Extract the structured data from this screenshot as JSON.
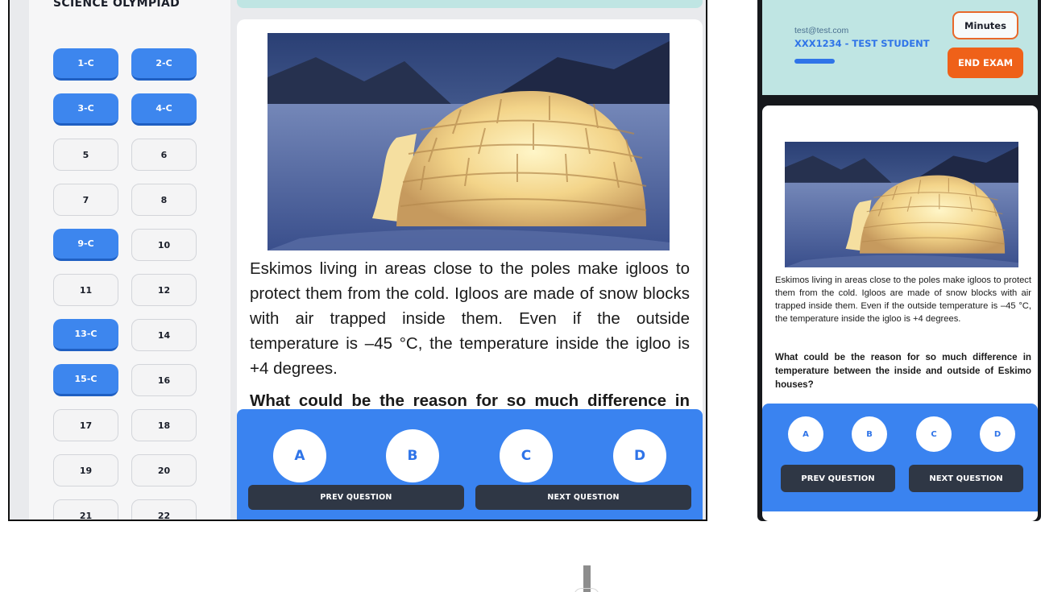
{
  "tablet": {
    "brand": "SCIENCE OLYMPIAD",
    "questions": [
      {
        "label": "1-C",
        "answered": true
      },
      {
        "label": "2-C",
        "answered": true
      },
      {
        "label": "3-C",
        "answered": true
      },
      {
        "label": "4-C",
        "answered": true
      },
      {
        "label": "5",
        "answered": false
      },
      {
        "label": "6",
        "answered": false
      },
      {
        "label": "7",
        "answered": false
      },
      {
        "label": "8",
        "answered": false
      },
      {
        "label": "9-C",
        "answered": true
      },
      {
        "label": "10",
        "answered": false
      },
      {
        "label": "11",
        "answered": false
      },
      {
        "label": "12",
        "answered": false
      },
      {
        "label": "13-C",
        "answered": true
      },
      {
        "label": "14",
        "answered": false
      },
      {
        "label": "15-C",
        "answered": true
      },
      {
        "label": "16",
        "answered": false
      },
      {
        "label": "17",
        "answered": false
      },
      {
        "label": "18",
        "answered": false
      },
      {
        "label": "19",
        "answered": false
      },
      {
        "label": "20",
        "answered": false
      },
      {
        "label": "21",
        "answered": false
      },
      {
        "label": "22",
        "answered": false
      }
    ],
    "question_text": "Eskimos living in areas close to the poles make igloos to protect them from the cold. Igloos are made of snow blocks with air trapped inside them. Even if the outside temperature is –45 °C, the temperature inside the igloo is +4 degrees.",
    "question_prompt": "What could be the reason for so much difference in temperature between the inside and outside of Eskimo houses?",
    "options": [
      "A",
      "B",
      "C",
      "D"
    ],
    "prev_label": "PREV QUESTION",
    "next_label": "NEXT QUESTION"
  },
  "phone": {
    "email": "test@test.com",
    "student": "XXX1234 - TEST STUDENT",
    "minutes_label": "Minutes",
    "end_exam_label": "END EXAM",
    "question_text": "Eskimos living in areas close to the poles make igloos to protect them from the cold. Igloos are made of snow blocks with air trapped inside them. Even if the outside temperature is –45 °C, the temperature inside the igloo is +4 degrees.",
    "question_prompt": "What could be the reason for so much difference in temperature between the inside and outside of Eskimo houses?",
    "options": [
      "A",
      "B",
      "C",
      "D"
    ],
    "prev_label": "PREV QUESTION",
    "next_label": "NEXT QUESTION"
  },
  "image": {
    "subject": "igloo-photo"
  },
  "colors": {
    "accent": "#3a83f0",
    "answered": "#3d86ee",
    "header": "#bfe5e3",
    "end_exam": "#ef6119",
    "nav_button": "#2f3745"
  }
}
